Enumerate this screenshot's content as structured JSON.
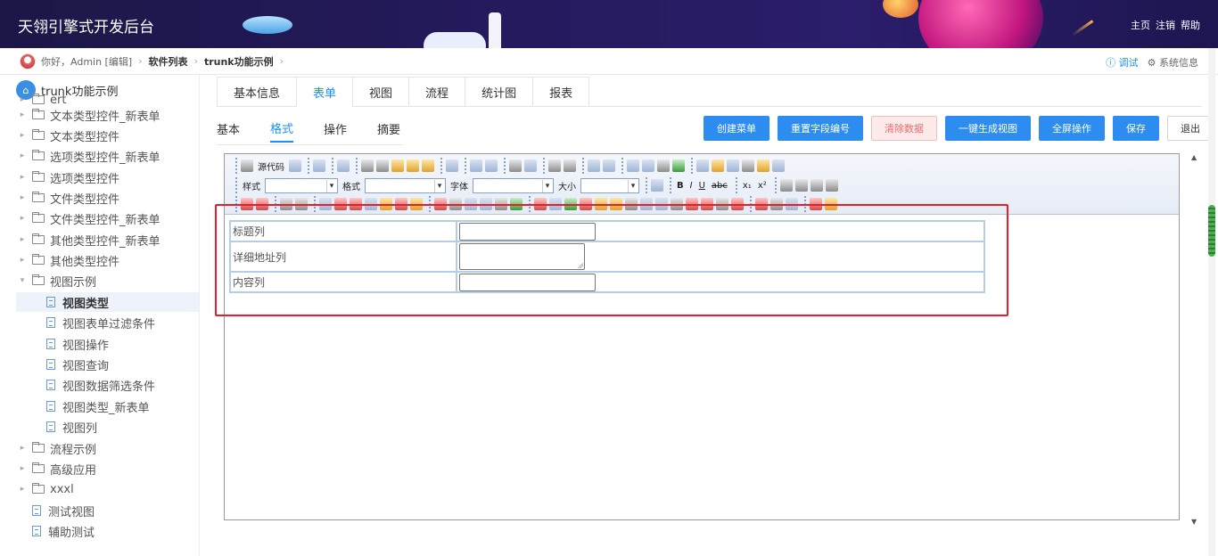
{
  "header": {
    "title": "天翎引擎式开发后台",
    "links": [
      "主页",
      "注销",
      "帮助"
    ]
  },
  "breadcrumb": {
    "greeting": "你好，Admin [编辑]",
    "items": [
      "软件列表",
      "trunk功能示例"
    ],
    "right": {
      "debug": "ⓘ 调试",
      "sysinfo": "⚙ 系统信息"
    }
  },
  "sidebar": {
    "root": "trunk功能示例",
    "items": [
      {
        "label": "ert",
        "type": "folder",
        "caret": "▸"
      },
      {
        "label": "文本类型控件_新表单",
        "type": "folder",
        "caret": "▸"
      },
      {
        "label": "文本类型控件",
        "type": "folder",
        "caret": "▸"
      },
      {
        "label": "选项类型控件_新表单",
        "type": "folder",
        "caret": "▸"
      },
      {
        "label": "选项类型控件",
        "type": "folder",
        "caret": "▸"
      },
      {
        "label": "文件类型控件",
        "type": "folder",
        "caret": "▸"
      },
      {
        "label": "文件类型控件_新表单",
        "type": "folder",
        "caret": "▸"
      },
      {
        "label": "其他类型控件_新表单",
        "type": "folder",
        "caret": "▸"
      },
      {
        "label": "其他类型控件",
        "type": "folder",
        "caret": "▸"
      },
      {
        "label": "视图示例",
        "type": "folder",
        "caret": "▾"
      },
      {
        "label": "视图类型",
        "type": "doc",
        "selected": true
      },
      {
        "label": "视图表单过滤条件",
        "type": "doc"
      },
      {
        "label": "视图操作",
        "type": "doc"
      },
      {
        "label": "视图查询",
        "type": "doc"
      },
      {
        "label": "视图数据筛选条件",
        "type": "doc"
      },
      {
        "label": "视图类型_新表单",
        "type": "doc"
      },
      {
        "label": "视图列",
        "type": "doc"
      },
      {
        "label": "流程示例",
        "type": "folder",
        "caret": "▸"
      },
      {
        "label": "高级应用",
        "type": "folder",
        "caret": "▸"
      },
      {
        "label": "xxxl",
        "type": "folder",
        "caret": "▸"
      },
      {
        "label": "测试视图",
        "type": "doc",
        "top": true
      },
      {
        "label": "辅助测试",
        "type": "doc",
        "top": true
      }
    ]
  },
  "main_tabs": [
    "基本信息",
    "表单",
    "视图",
    "流程",
    "统计图",
    "报表"
  ],
  "sub_tabs": [
    "基本",
    "格式",
    "操作",
    "摘要"
  ],
  "actions": [
    "创建菜单",
    "重置字段编号",
    "清除数据",
    "一键生成视图",
    "全屏操作",
    "保存",
    "退出"
  ],
  "toolbar": {
    "source": "源代码",
    "style": "样式",
    "format": "格式",
    "font": "字体",
    "size": "大小"
  },
  "form": {
    "rows": [
      "标题列",
      "详细地址列",
      "内容列"
    ]
  }
}
